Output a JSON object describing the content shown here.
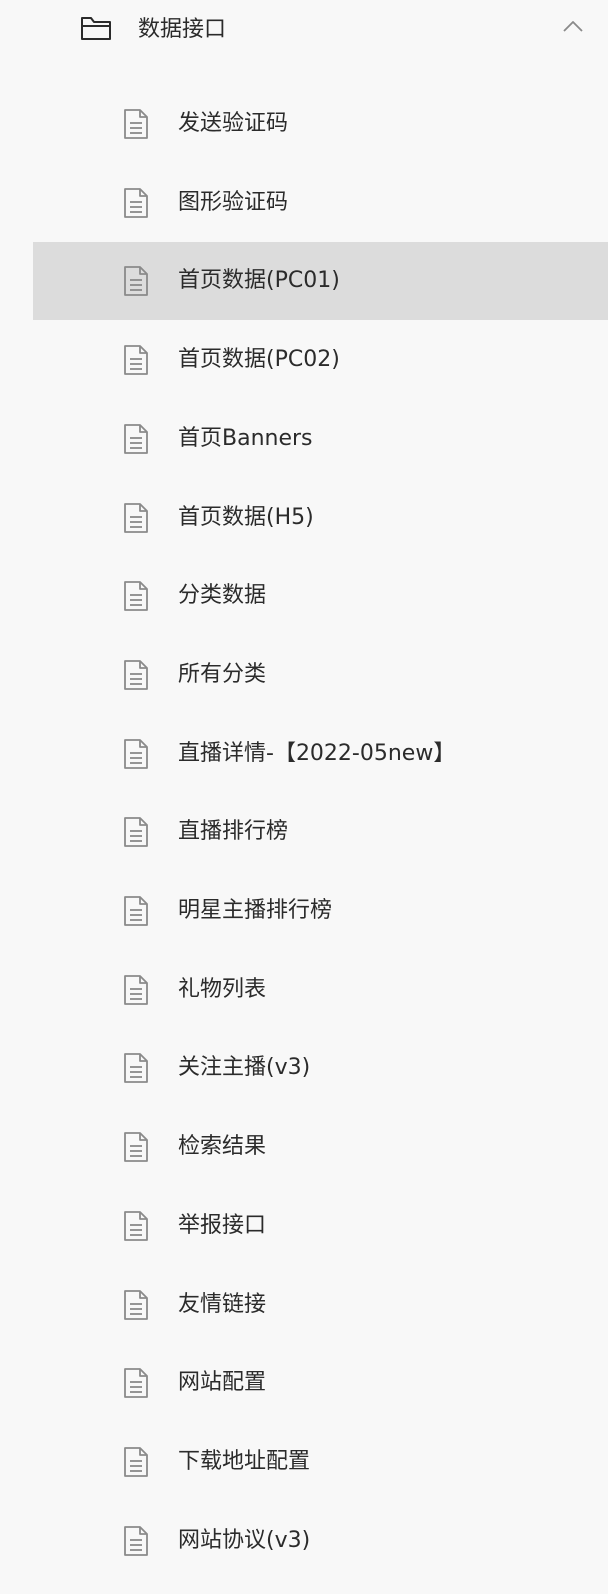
{
  "folder": {
    "label": "数据接口",
    "icon": "folder-icon",
    "expanded": true,
    "toggle_icon": "chevron-up-icon"
  },
  "selected_index": 2,
  "colors": {
    "background": "#f8f8f8",
    "selected_background": "#dcdcdc",
    "text": "#2b2b2b",
    "icon": "#8a8a8a"
  },
  "items": [
    {
      "label": "发送验证码",
      "icon": "document-icon"
    },
    {
      "label": "图形验证码",
      "icon": "document-icon"
    },
    {
      "label": "首页数据(PC01)",
      "icon": "document-icon"
    },
    {
      "label": "首页数据(PC02)",
      "icon": "document-icon"
    },
    {
      "label": "首页Banners",
      "icon": "document-icon"
    },
    {
      "label": "首页数据(H5)",
      "icon": "document-icon"
    },
    {
      "label": "分类数据",
      "icon": "document-icon"
    },
    {
      "label": "所有分类",
      "icon": "document-icon"
    },
    {
      "label": "直播详情-【2022-05new】",
      "icon": "document-icon"
    },
    {
      "label": "直播排行榜",
      "icon": "document-icon"
    },
    {
      "label": "明星主播排行榜",
      "icon": "document-icon"
    },
    {
      "label": "礼物列表",
      "icon": "document-icon"
    },
    {
      "label": "关注主播(v3)",
      "icon": "document-icon"
    },
    {
      "label": "检索结果",
      "icon": "document-icon"
    },
    {
      "label": "举报接口",
      "icon": "document-icon"
    },
    {
      "label": "友情链接",
      "icon": "document-icon"
    },
    {
      "label": "网站配置",
      "icon": "document-icon"
    },
    {
      "label": "下载地址配置",
      "icon": "document-icon"
    },
    {
      "label": "网站协议(v3)",
      "icon": "document-icon"
    }
  ]
}
